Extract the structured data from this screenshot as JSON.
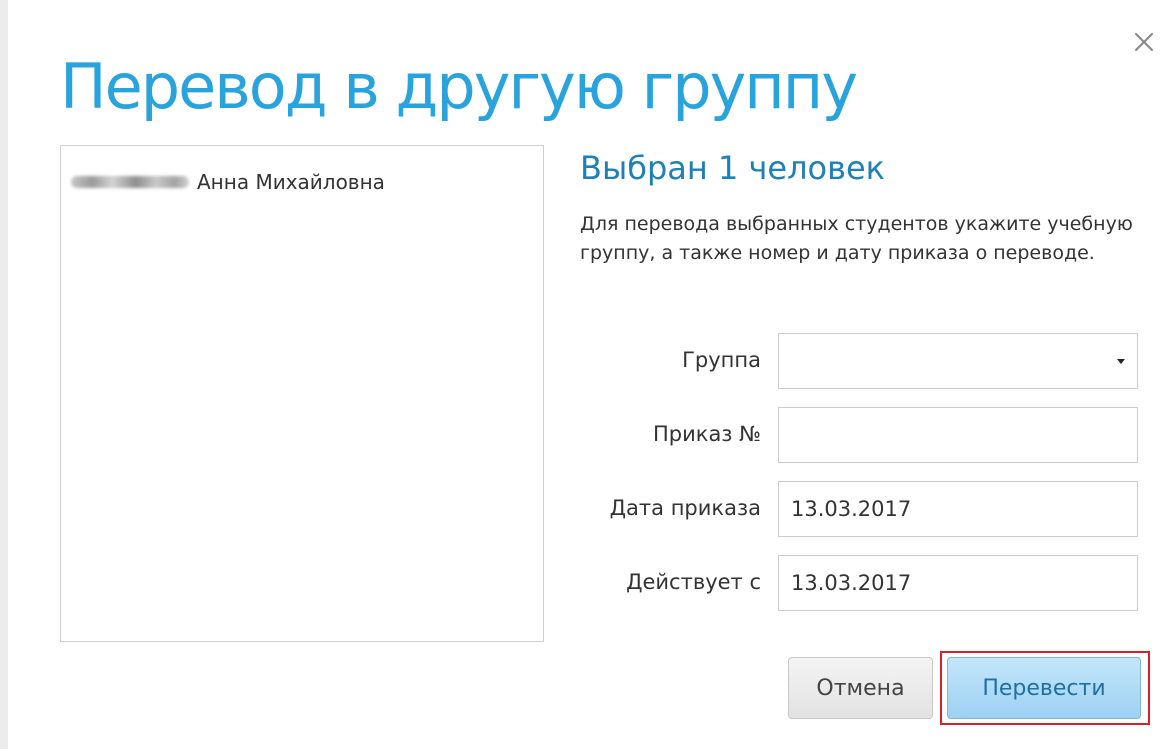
{
  "dialog": {
    "title": "Перевод в другую группу",
    "close_icon": "close-icon"
  },
  "students": {
    "items": [
      {
        "first_and_middle_name": "Анна Михайловна"
      }
    ]
  },
  "selection": {
    "heading": "Выбран 1 человек",
    "instructions": "Для перевода выбранных студентов укажите учебную группу, а также номер и дату приказа о переводе."
  },
  "form": {
    "group": {
      "label": "Группа",
      "value": ""
    },
    "order_number": {
      "label": "Приказ №",
      "value": ""
    },
    "order_date": {
      "label": "Дата приказа",
      "value": "13.03.2017"
    },
    "effective_from": {
      "label": "Действует с",
      "value": "13.03.2017"
    }
  },
  "buttons": {
    "cancel_label": "Отмена",
    "transfer_label": "Перевести"
  },
  "colors": {
    "title": "#29a3dd",
    "heading": "#1f7fb8",
    "highlight_border": "#d9202a",
    "primary_button_bg": "#aedcf6"
  }
}
